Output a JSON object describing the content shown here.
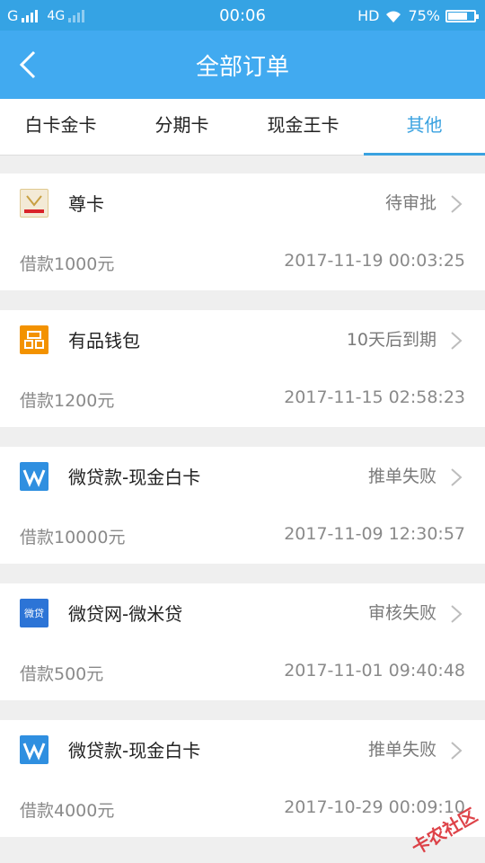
{
  "status_bar": {
    "carrier_1": "G",
    "carrier_2": "4G",
    "time": "00:06",
    "hd": "HD",
    "battery": "75%",
    "battery_level": 0.75
  },
  "header": {
    "title": "全部订单",
    "back_icon": "chevron-left-icon"
  },
  "tabs": [
    {
      "label": "白卡金卡"
    },
    {
      "label": "分期卡"
    },
    {
      "label": "现金王卡"
    },
    {
      "label": "其他",
      "active": true
    }
  ],
  "orders": [
    {
      "name": "尊卡",
      "status": "待审批",
      "amount": "借款1000元",
      "time": "2017-11-19 00:03:25",
      "logo": "zunka-logo-icon",
      "logo_color": "#f3ead6"
    },
    {
      "name": "有品钱包",
      "status": "10天后到期",
      "amount": "借款1200元",
      "time": "2017-11-15 02:58:23",
      "logo": "youpin-logo-icon",
      "logo_color": "#f39200"
    },
    {
      "name": "微贷款-现金白卡",
      "status": "推单失败",
      "amount": "借款10000元",
      "time": "2017-11-09 12:30:57",
      "logo": "weidai-logo-icon",
      "logo_color": "#2f8fe0"
    },
    {
      "name": "微贷网-微米贷",
      "status": "审核失败",
      "amount": "借款500元",
      "time": "2017-11-01 09:40:48",
      "logo": "weidaiwang-logo-icon",
      "logo_text": "微贷",
      "logo_color": "#2c74d6"
    },
    {
      "name": "微贷款-现金白卡",
      "status": "推单失败",
      "amount": "借款4000元",
      "time": "2017-10-29 00:09:10",
      "logo": "weidai-logo-icon",
      "logo_color": "#2f8fe0"
    }
  ],
  "watermark": "卡农社区",
  "colors": {
    "header": "#41aaf0",
    "status_bar": "#35a3e4",
    "active_tab": "#3aa2e0"
  }
}
